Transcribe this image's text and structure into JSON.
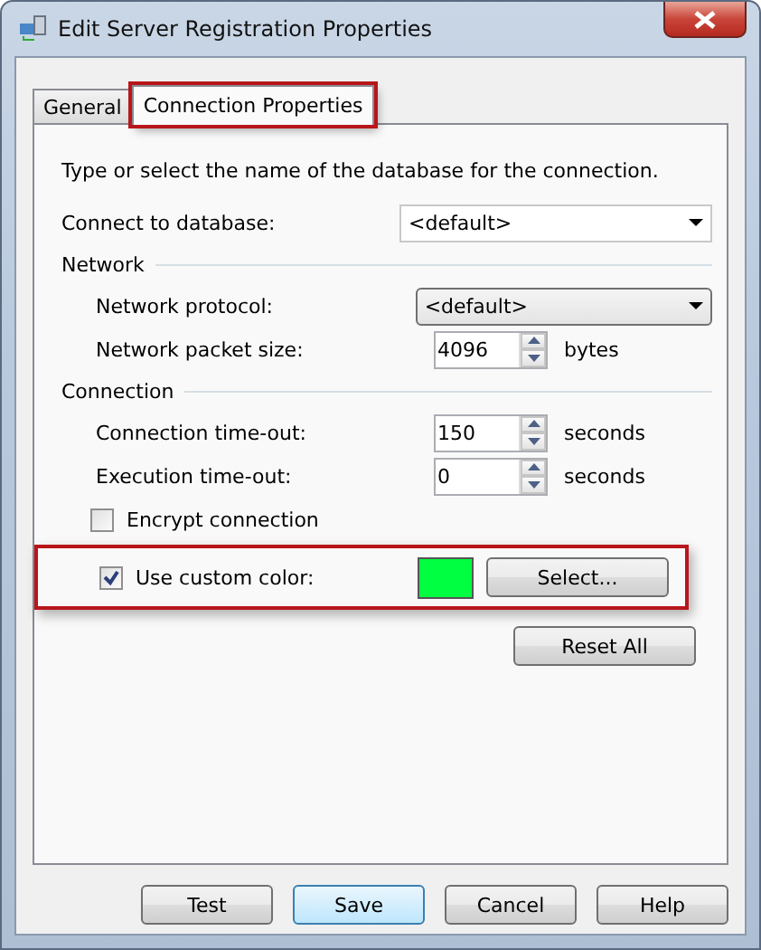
{
  "window": {
    "title": "Edit Server Registration Properties"
  },
  "tabs": [
    {
      "label": "General",
      "selected": false,
      "highlighted": false
    },
    {
      "label": "Connection Properties",
      "selected": true,
      "highlighted": true
    }
  ],
  "intro": "Type or select the name of the database for the connection.",
  "database": {
    "label": "Connect to database:",
    "value": "<default>"
  },
  "sections": [
    {
      "title": "Network",
      "rows": [
        {
          "kind": "dropdown",
          "label": "Network protocol:",
          "value": "<default>"
        },
        {
          "kind": "spin",
          "label": "Network packet size:",
          "value": "4096",
          "unit": "bytes"
        }
      ]
    },
    {
      "title": "Connection",
      "rows": [
        {
          "kind": "spin",
          "label": "Connection time-out:",
          "value": "150",
          "unit": "seconds"
        },
        {
          "kind": "spin",
          "label": "Execution time-out:",
          "value": "0",
          "unit": "seconds"
        },
        {
          "kind": "checkbox",
          "label": "Encrypt connection",
          "checked": false
        },
        {
          "kind": "color",
          "label": "Use custom color:",
          "checked": true,
          "color": "#00ff40",
          "button": "Select...",
          "highlighted": true
        }
      ]
    }
  ],
  "reset_button": "Reset All",
  "buttons": [
    {
      "label": "Test",
      "default": false
    },
    {
      "label": "Save",
      "default": true
    },
    {
      "label": "Cancel",
      "default": false
    },
    {
      "label": "Help",
      "default": false
    }
  ]
}
